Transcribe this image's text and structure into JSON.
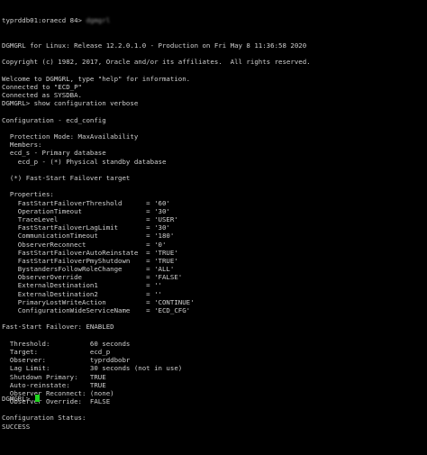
{
  "terminal": {
    "first_line": {
      "prefix": "typrddb01:oraecd 84> ",
      "hidden_command": "dgmgrl"
    },
    "lines": [
      "DGMGRL for Linux: Release 12.2.0.1.0 - Production on Fri May 8 11:36:58 2020",
      "",
      "Copyright (c) 1982, 2017, Oracle and/or its affiliates.  All rights reserved.",
      "",
      "Welcome to DGMGRL, type \"help\" for information.",
      "Connected to \"ECD_P\"",
      "Connected as SYSDBA.",
      "DGMGRL> show configuration verbose",
      "",
      "Configuration - ecd_config",
      "",
      "  Protection Mode: MaxAvailability",
      "  Members:",
      "  ecd_s - Primary database",
      "    ecd_p - (*) Physical standby database",
      "",
      "  (*) Fast-Start Failover target",
      "",
      "  Properties:",
      "    FastStartFailoverThreshold      = '60'",
      "    OperationTimeout                = '30'",
      "    TraceLevel                      = 'USER'",
      "    FastStartFailoverLagLimit       = '30'",
      "    CommunicationTimeout            = '180'",
      "    ObserverReconnect               = '0'",
      "    FastStartFailoverAutoReinstate  = 'TRUE'",
      "    FastStartFailoverPmyShutdown    = 'TRUE'",
      "    BystandersFollowRoleChange      = 'ALL'",
      "    ObserverOverride                = 'FALSE'",
      "    ExternalDestination1            = ''",
      "    ExternalDestination2            = ''",
      "    PrimaryLostWriteAction          = 'CONTINUE'",
      "    ConfigurationWideServiceName    = 'ECD_CFG'",
      "",
      "Fast-Start Failover: ENABLED",
      "",
      "  Threshold:          60 seconds",
      "  Target:             ecd_p",
      "  Observer:           typrddbobr",
      "  Lag Limit:          30 seconds (not in use)",
      "  Shutdown Primary:   TRUE",
      "  Auto-reinstate:     TRUE",
      "  Observer Reconnect: (none)",
      "  Observer Override:  FALSE",
      "",
      "Configuration Status:",
      "SUCCESS",
      ""
    ],
    "prompt": "DGMGRL> "
  },
  "colors": {
    "background": "#000000",
    "text": "#cfcfcf",
    "cursor": "#1fd51f"
  }
}
